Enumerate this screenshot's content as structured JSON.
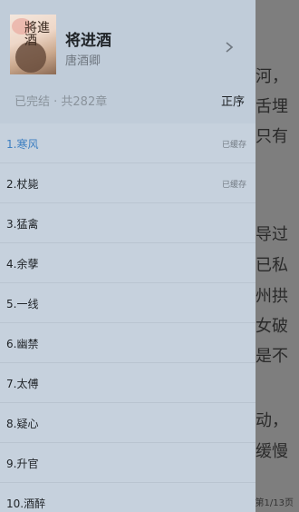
{
  "reader": {
    "lines": [
      "河，",
      "舌埋",
      "只有",
      "",
      "导过",
      "已私",
      "州拱",
      "女破",
      "是不",
      "",
      "动，",
      "缓慢"
    ],
    "page_info": "第1/13页"
  },
  "book": {
    "title": "将进酒",
    "author": "唐酒卿",
    "cover_text": "將進酒",
    "status": "已完结 · 共282章",
    "order_label": "正序"
  },
  "chapters": [
    {
      "name": "1.寒风",
      "cache": "已缓存",
      "active": true
    },
    {
      "name": "2.杖毙",
      "cache": "已缓存",
      "active": false
    },
    {
      "name": "3.猛禽",
      "cache": "",
      "active": false
    },
    {
      "name": "4.余孽",
      "cache": "",
      "active": false
    },
    {
      "name": "5.一线",
      "cache": "",
      "active": false
    },
    {
      "name": "6.幽禁",
      "cache": "",
      "active": false
    },
    {
      "name": "7.太傅",
      "cache": "",
      "active": false
    },
    {
      "name": "8.疑心",
      "cache": "",
      "active": false
    },
    {
      "name": "9.升官",
      "cache": "",
      "active": false
    },
    {
      "name": "10.酒醉",
      "cache": "",
      "active": false
    }
  ]
}
